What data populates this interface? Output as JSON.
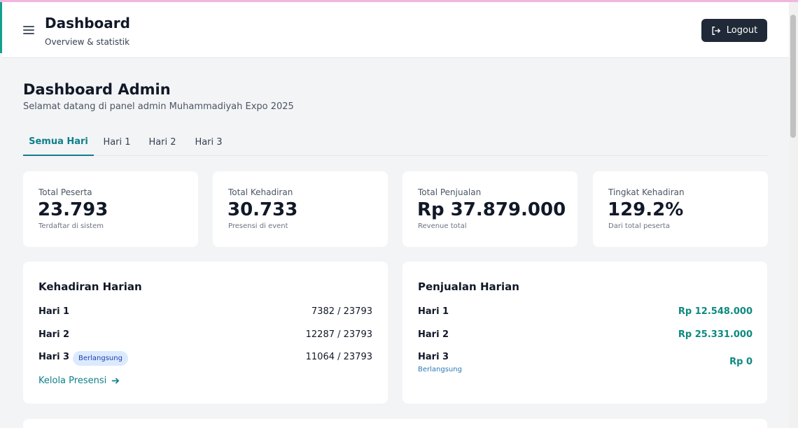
{
  "colors": {
    "accent": "#0e7f8a",
    "money": "#0e8a80",
    "dark_button": "#1f2937",
    "badge_bg": "#dbeafe"
  },
  "header": {
    "menu_icon": "hamburger-icon",
    "title": "Dashboard",
    "subtitle": "Overview & statistik",
    "logout_icon": "logout-icon",
    "logout_label": "Logout"
  },
  "page": {
    "title": "Dashboard Admin",
    "subtitle": "Selamat datang di panel admin Muhammadiyah Expo 2025"
  },
  "tabs": [
    {
      "label": "Semua Hari",
      "active": true
    },
    {
      "label": "Hari 1",
      "active": false
    },
    {
      "label": "Hari 2",
      "active": false
    },
    {
      "label": "Hari 3",
      "active": false
    }
  ],
  "stats": [
    {
      "label": "Total Peserta",
      "value": "23.793",
      "note": "Terdaftar di sistem"
    },
    {
      "label": "Total Kehadiran",
      "value": "30.733",
      "note": "Presensi di event"
    },
    {
      "label": "Total Penjualan",
      "value": "Rp 37.879.000",
      "note": "Revenue total"
    },
    {
      "label": "Tingkat Kehadiran",
      "value": "129.2%",
      "note": "Dari total peserta"
    }
  ],
  "attendance": {
    "title": "Kehadiran Harian",
    "rows": [
      {
        "label": "Hari 1",
        "value": "7382 / 23793"
      },
      {
        "label": "Hari 2",
        "value": "12287 / 23793"
      },
      {
        "label": "Hari 3",
        "value": "11064 / 23793",
        "badge": "Berlangsung"
      }
    ],
    "link_label": "Kelola Presensi",
    "link_icon": "arrow-right-icon"
  },
  "sales": {
    "title": "Penjualan Harian",
    "rows": [
      {
        "label": "Hari 1",
        "value": "Rp 12.548.000"
      },
      {
        "label": "Hari 2",
        "value": "Rp 25.331.000"
      },
      {
        "label": "Hari 3",
        "value": "Rp 0",
        "status": "Berlangsung"
      }
    ]
  }
}
